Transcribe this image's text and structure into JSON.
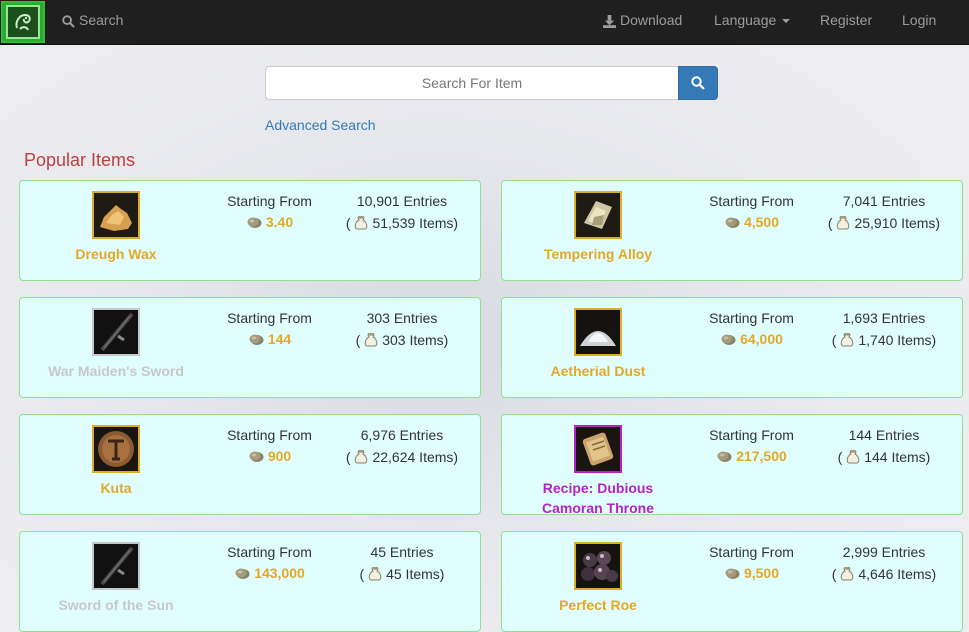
{
  "nav": {
    "search_label": "Search",
    "download_label": "Download",
    "language_label": "Language",
    "register_label": "Register",
    "login_label": "Login"
  },
  "search": {
    "placeholder": "Search For Item",
    "advanced_label": "Advanced Search"
  },
  "popular": {
    "title": "Popular Items",
    "starting_from_label": "Starting From",
    "cards": [
      {
        "name": "Dreugh Wax",
        "rarity": "gold",
        "icon": "dreugh-wax-icon",
        "price": "3.40",
        "entries": "10,901 Entries",
        "items": "51,539 Items)"
      },
      {
        "name": "Tempering Alloy",
        "rarity": "gold",
        "icon": "tempering-alloy-icon",
        "price": "4,500",
        "entries": "7,041 Entries",
        "items": "25,910 Items)"
      },
      {
        "name": "War Maiden's Sword",
        "rarity": "gray",
        "icon": "sword-icon",
        "price": "144",
        "entries": "303 Entries",
        "items": "303 Items)"
      },
      {
        "name": "Aetherial Dust",
        "rarity": "gold",
        "icon": "aetherial-dust-icon",
        "price": "64,000",
        "entries": "1,693 Entries",
        "items": "1,740 Items)"
      },
      {
        "name": "Kuta",
        "rarity": "gold",
        "icon": "kuta-rune-icon",
        "price": "900",
        "entries": "6,976 Entries",
        "items": "22,624 Items)"
      },
      {
        "name_line1": "Recipe: Dubious",
        "name_line2": "Camoran Throne",
        "rarity": "purple",
        "icon": "recipe-scroll-icon",
        "price": "217,500",
        "entries": "144 Entries",
        "items": "144 Items)"
      },
      {
        "name": "Sword of the Sun",
        "rarity": "gray",
        "icon": "sword-icon",
        "price": "143,000",
        "entries": "45 Entries",
        "items": "45 Items)"
      },
      {
        "name": "Perfect Roe",
        "rarity": "gold",
        "icon": "perfect-roe-icon",
        "price": "9,500",
        "entries": "2,999 Entries",
        "items": "4,646 Items)"
      }
    ]
  },
  "colors": {
    "navbar_bg": "#1f1f1f",
    "accent_blue": "#337ab7",
    "title_red": "#b9403f",
    "card_bg": "#e0fefe",
    "card_border": "#8fe08f",
    "gold": "#e4a826",
    "purple": "#b622c4",
    "gray_item": "#c8c8c8"
  }
}
